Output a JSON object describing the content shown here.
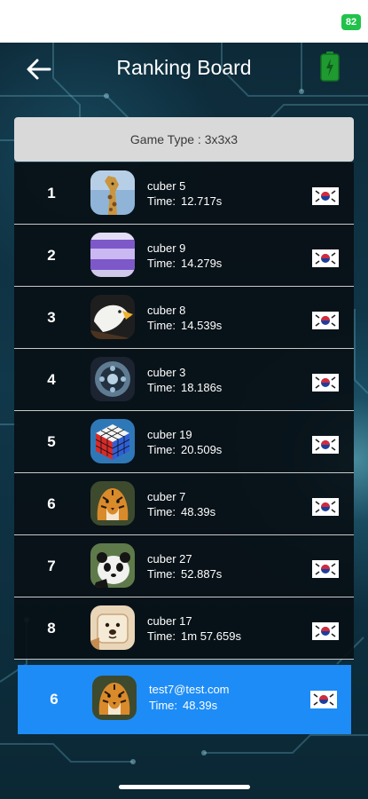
{
  "status_bar": {
    "battery": "82"
  },
  "header": {
    "title": "Ranking Board"
  },
  "game_type": {
    "label": "Game Type : ",
    "value": "3x3x3"
  },
  "time_label": "Time:",
  "rankings": [
    {
      "rank": "1",
      "name": "cuber 5",
      "time": "12.717s",
      "avatar": "giraffe"
    },
    {
      "rank": "2",
      "name": "cuber 9",
      "time": "14.279s",
      "avatar": "purple"
    },
    {
      "rank": "3",
      "name": "cuber 8",
      "time": "14.539s",
      "avatar": "eagle"
    },
    {
      "rank": "4",
      "name": "cuber 3",
      "time": "18.186s",
      "avatar": "gear"
    },
    {
      "rank": "5",
      "name": "cuber 19",
      "time": "20.509s",
      "avatar": "cube"
    },
    {
      "rank": "6",
      "name": "cuber 7",
      "time": "48.39s",
      "avatar": "tiger"
    },
    {
      "rank": "7",
      "name": "cuber 27",
      "time": "52.887s",
      "avatar": "panda"
    },
    {
      "rank": "8",
      "name": "cuber 17",
      "time": "1m 57.659s",
      "avatar": "dog"
    }
  ],
  "my_rank": {
    "rank": "6",
    "name": "test7@test.com",
    "time": "48.39s",
    "avatar": "tiger"
  },
  "colors": {
    "highlight": "#1e8cf6",
    "battery_green": "#21c24a"
  }
}
